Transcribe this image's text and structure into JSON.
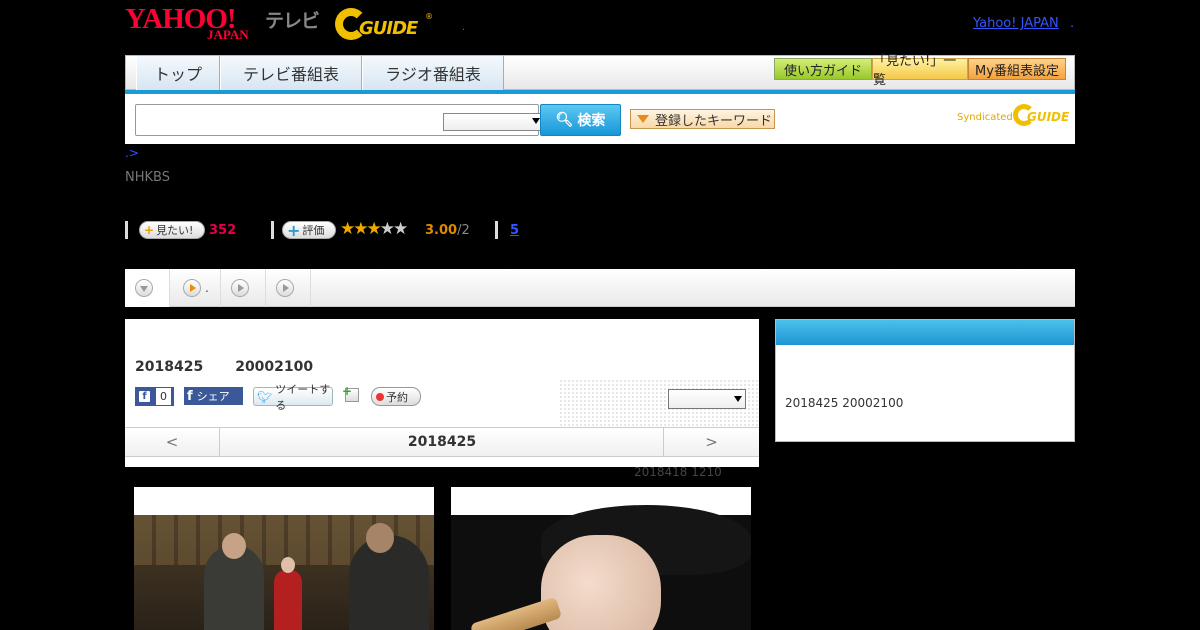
{
  "header": {
    "yahoo_logo_main": "YAHOO!",
    "yahoo_logo_sub": "JAPAN",
    "tv_label": "テレビ",
    "gguide_logo": "GUIDE",
    "separator_dot": ".",
    "yahoo_japan_link": "Yahoo! JAPAN",
    "trailing_dot": "."
  },
  "nav": {
    "tabs": [
      "トップ",
      "テレビ番組表",
      "ラジオ番組表"
    ],
    "guide_button": "使い方ガイド",
    "watchlist_button": "「見たい!」一覧",
    "my_schedule_button": "My番組表設定"
  },
  "search": {
    "input_value": "",
    "select_value": "",
    "search_button": "検索",
    "keyword_button": "登録したキーワード",
    "syndicated_label": "Syndicated",
    "syndicated_logo": "GUIDE"
  },
  "breadcrumb": ".>",
  "channel": "NHKBS",
  "stats": {
    "want_label": "見たい!",
    "want_count": "352",
    "rate_label": "評価",
    "stars_filled": 3,
    "stars_total": 5,
    "rating": "3.00",
    "rating_denominator": "/2",
    "reviews_link": "5"
  },
  "subtabs": [
    {
      "label": ""
    },
    {
      "label": "."
    },
    {
      "label": ""
    },
    {
      "label": ""
    }
  ],
  "program": {
    "date": "2018425",
    "time": "20002100",
    "fb_count": "0",
    "share_label": "シェア",
    "tweet_label": "ツイートする",
    "record_label": "予約",
    "select_value": ""
  },
  "pager": {
    "prev": "<",
    "current": "2018425",
    "next": ">"
  },
  "rebroadcast_note": "2018418  1210",
  "sidebar": {
    "text": "2018425  20002100"
  },
  "colors": {
    "accent_blue": "#1a9ad6",
    "want_count": "#e0004d",
    "rating": "#e08a00",
    "star_on": "#f0a800"
  }
}
